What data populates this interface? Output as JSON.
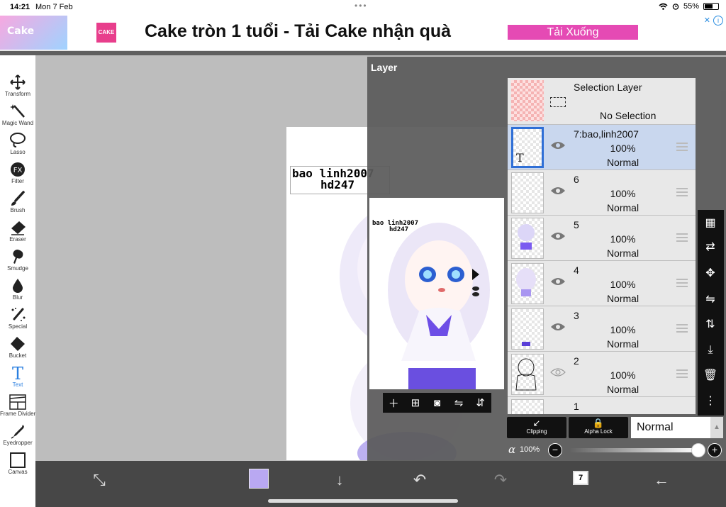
{
  "status_bar": {
    "time": "14:21",
    "date": "Mon 7 Feb",
    "battery": "55%"
  },
  "ad": {
    "thumb_text": "Cake",
    "logo_text": "CAKE",
    "headline": "Cake tròn 1 tuổi - Tải Cake nhận quà",
    "cta": "Tải Xuống",
    "info_icon": "i"
  },
  "tools": [
    {
      "label": "Transform",
      "icon": "move-icon"
    },
    {
      "label": "Magic Wand",
      "icon": "magic-wand-icon"
    },
    {
      "label": "Lasso",
      "icon": "lasso-icon"
    },
    {
      "label": "Filter",
      "icon": "fx-icon"
    },
    {
      "label": "Brush",
      "icon": "brush-icon"
    },
    {
      "label": "Eraser",
      "icon": "eraser-icon"
    },
    {
      "label": "Smudge",
      "icon": "smudge-icon"
    },
    {
      "label": "Blur",
      "icon": "blur-drop-icon"
    },
    {
      "label": "Special",
      "icon": "special-icon"
    },
    {
      "label": "Bucket",
      "icon": "bucket-icon"
    },
    {
      "label": "Text",
      "icon": "text-icon",
      "active": true
    },
    {
      "label": "Frame Divider",
      "icon": "frame-divider-icon"
    },
    {
      "label": "Eyedropper",
      "icon": "eyedropper-icon"
    },
    {
      "label": "Canvas",
      "icon": "canvas-icon"
    }
  ],
  "canvas": {
    "text_line1": "bao linh2007",
    "text_line2": "hd247"
  },
  "layer_panel": {
    "title": "Layer",
    "selection_layer": {
      "name": "Selection Layer",
      "status": "No Selection"
    },
    "layers": [
      {
        "name": "7:bao,linh2007",
        "opacity": "100%",
        "blend": "Normal",
        "selected": true
      },
      {
        "name": "6",
        "opacity": "100%",
        "blend": "Normal"
      },
      {
        "name": "5",
        "opacity": "100%",
        "blend": "Normal"
      },
      {
        "name": "4",
        "opacity": "100%",
        "blend": "Normal"
      },
      {
        "name": "3",
        "opacity": "100%",
        "blend": "Normal"
      },
      {
        "name": "2",
        "opacity": "100%",
        "blend": "Normal"
      },
      {
        "name": "1",
        "opacity": "",
        "blend": ""
      }
    ],
    "clipping_label": "Clipping",
    "alpha_lock_label": "Alpha Lock",
    "blend_mode": "Normal",
    "alpha_symbol": "α",
    "alpha_value": "100%",
    "alpha_level": 1.0
  },
  "bottom_bar": {
    "current_color": "#b9a8f2",
    "layer_count": "7"
  },
  "colors": {
    "accent_blue": "#2f6fd6",
    "cta_pink": "#e54ab4",
    "hair_purple": "#7b5cf0"
  }
}
